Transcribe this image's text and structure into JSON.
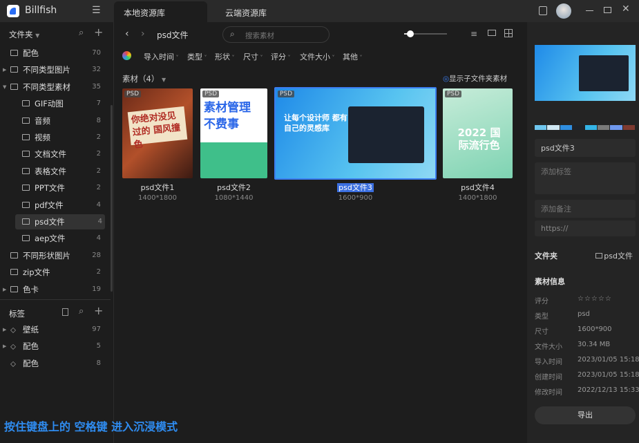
{
  "app": {
    "name": "Billfish"
  },
  "tabs": [
    {
      "label": "本地资源库"
    },
    {
      "label": "云端资源库"
    }
  ],
  "sidebar": {
    "folders_title": "文件夹",
    "folders": [
      {
        "label": "配色",
        "count": "70"
      },
      {
        "label": "不同类型图片",
        "count": "32"
      },
      {
        "label": "不同类型素材",
        "count": "35"
      },
      {
        "label": "GIF动图",
        "count": "7"
      },
      {
        "label": "音频",
        "count": "8"
      },
      {
        "label": "视频",
        "count": "2"
      },
      {
        "label": "文档文件",
        "count": "2"
      },
      {
        "label": "表格文件",
        "count": "2"
      },
      {
        "label": "PPT文件",
        "count": "2"
      },
      {
        "label": "pdf文件",
        "count": "4"
      },
      {
        "label": "psd文件",
        "count": "4"
      },
      {
        "label": "aep文件",
        "count": "4"
      },
      {
        "label": "不同形状图片",
        "count": "28"
      },
      {
        "label": "zip文件",
        "count": "2"
      },
      {
        "label": "色卡",
        "count": "19"
      }
    ],
    "tags_title": "标签",
    "tags": [
      {
        "label": "壁纸",
        "count": "97"
      },
      {
        "label": "配色",
        "count": "5"
      },
      {
        "label": "配色",
        "count": "8"
      }
    ]
  },
  "toolbar": {
    "breadcrumb": "psd文件",
    "search_placeholder": "搜索素材"
  },
  "filters": [
    "导入时间",
    "类型",
    "形状",
    "尺寸",
    "评分",
    "文件大小",
    "其他"
  ],
  "content": {
    "title": "素材（4）",
    "show_sub": "显示子文件夹素材",
    "items": [
      {
        "name": "psd文件1",
        "dim": "1400*1800",
        "badge": "PSD",
        "art": "你绝对没见过的 国风撞色"
      },
      {
        "name": "psd文件2",
        "dim": "1080*1440",
        "badge": "PSD",
        "art": "素材管理 不费事"
      },
      {
        "name": "psd文件3",
        "dim": "1600*900",
        "badge": "PSD",
        "art": "让每个设计师 都有自己的灵感库"
      },
      {
        "name": "psd文件4",
        "dim": "1400*1800",
        "badge": "PSD",
        "art": "2022 国际流行色"
      }
    ]
  },
  "detail": {
    "palette": [
      "#6fc6ee",
      "#cfe7f3",
      "#2f8ee0",
      "#1f2329",
      "#34b4e6",
      "#7a7a7a",
      "#6f98ee",
      "#7e3a30"
    ],
    "name": "psd文件3",
    "tags_placeholder": "添加标签",
    "note_placeholder": "添加备注",
    "url_placeholder": "https://",
    "folder_label": "文件夹",
    "folder_value": "psd文件",
    "info_title": "素材信息",
    "stars": "☆☆☆☆☆",
    "info": [
      {
        "k": "评分",
        "v": ""
      },
      {
        "k": "类型",
        "v": "psd"
      },
      {
        "k": "尺寸",
        "v": "1600*900"
      },
      {
        "k": "文件大小",
        "v": "30.34 MB"
      },
      {
        "k": "导入时间",
        "v": "2023/01/05 15:18"
      },
      {
        "k": "创建时间",
        "v": "2023/01/05 15:18"
      },
      {
        "k": "修改时间",
        "v": "2022/12/13 15:33"
      }
    ],
    "export": "导出"
  },
  "hint": "按住键盘上的 空格键 进入沉浸模式"
}
